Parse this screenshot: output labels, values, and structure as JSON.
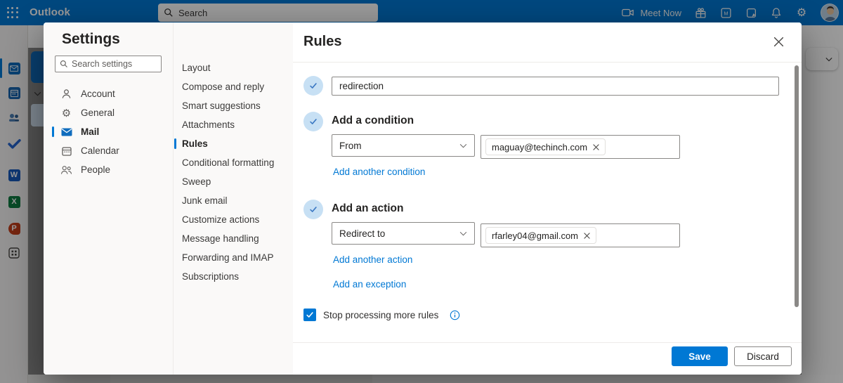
{
  "topbar": {
    "app_title": "Outlook",
    "search_placeholder": "Search",
    "meet_now_label": "Meet Now",
    "icons": [
      "waffle-icon",
      "search-icon",
      "video-camera-icon",
      "gift-icon",
      "whats-new-icon",
      "notes-icon",
      "bell-icon",
      "gear-icon",
      "avatar"
    ]
  },
  "rail": {
    "items": [
      "mail",
      "calendar",
      "people",
      "todo",
      "word",
      "excel",
      "powerpoint",
      "all-apps"
    ]
  },
  "settings": {
    "title": "Settings",
    "search_placeholder": "Search settings",
    "nav": [
      {
        "label": "Account",
        "icon": "person-icon"
      },
      {
        "label": "General",
        "icon": "gear-icon"
      },
      {
        "label": "Mail",
        "icon": "mail-icon",
        "selected": true
      },
      {
        "label": "Calendar",
        "icon": "calendar-icon"
      },
      {
        "label": "People",
        "icon": "people-icon"
      }
    ],
    "categories": [
      "Layout",
      "Compose and reply",
      "Smart suggestions",
      "Attachments",
      "Rules",
      "Conditional formatting",
      "Sweep",
      "Junk email",
      "Customize actions",
      "Message handling",
      "Forwarding and IMAP",
      "Subscriptions"
    ],
    "selected_category": "Rules"
  },
  "rules": {
    "title": "Rules",
    "rule_name": "redirection",
    "condition_heading": "Add a condition",
    "condition_selector": "From",
    "condition_chip": "maguay@techinch.com",
    "add_condition_link": "Add another condition",
    "action_heading": "Add an action",
    "action_selector": "Redirect to",
    "action_chip": "rfarley04@gmail.com",
    "add_action_link": "Add another action",
    "add_exception_link": "Add an exception",
    "stop_processing_label": "Stop processing more rules",
    "stop_processing_checked": true,
    "save_label": "Save",
    "discard_label": "Discard"
  },
  "colors": {
    "accent": "#0078d4",
    "topbar_bg": "#0078d4",
    "link": "#0078d4",
    "badge_bg": "#c7e0f4",
    "badge_check": "#3b78c3"
  }
}
